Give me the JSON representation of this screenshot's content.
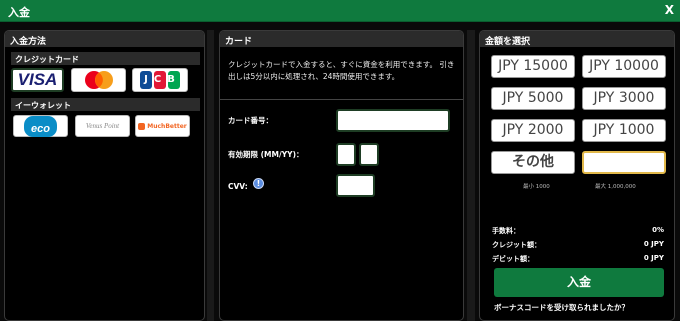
{
  "window": {
    "title": "入金",
    "close": "X"
  },
  "left": {
    "heading": "入金方法",
    "credit_heading": "クレジットカード",
    "credit": [
      {
        "name": "VISA",
        "icon": "visa-logo"
      },
      {
        "name": "",
        "icon": "mastercard-logo"
      },
      {
        "name": "JCB",
        "icon": "jcb-logo"
      }
    ],
    "ewallet_heading": "イーウォレット",
    "ewallet": [
      {
        "name": "eco",
        "icon": "ecopayz-logo"
      },
      {
        "name": "Venus Point",
        "icon": "venus-point-logo"
      },
      {
        "name": "MuchBetter",
        "icon": "muchbetter-logo"
      }
    ]
  },
  "mid": {
    "heading": "カード",
    "description": "クレジットカードで入金すると、すぐに資金を利用できます。 引き出しは5分以内に処理され、24時間使用できます。",
    "card_number_label": "カード番号：",
    "expiry_label": "有効期限 (MM/YY)：",
    "cvv_label": "CVV:",
    "cvv_info_icon": "info-icon"
  },
  "right": {
    "heading": "金額を選択",
    "amounts": [
      "JPY 15000",
      "JPY 10000",
      "JPY 5000",
      "JPY 3000",
      "JPY 2000",
      "JPY 1000"
    ],
    "other_label": "その他",
    "min_label": "最小 1000",
    "max_label": "最大 1,000,000",
    "fee_label": "手数料：",
    "fee_value": "0%",
    "credit_label": "クレジット額：",
    "credit_value": "0 JPY",
    "debit_label": "デビット額：",
    "debit_value": "0 JPY",
    "deposit_button": "入金",
    "bonus_link": "ボーナスコードを受け取られましたか？"
  },
  "colors": {
    "accent": "#0f7a3e",
    "panel": "#000000",
    "header": "#2b2b2b",
    "selected_border": "#e1b84a"
  }
}
